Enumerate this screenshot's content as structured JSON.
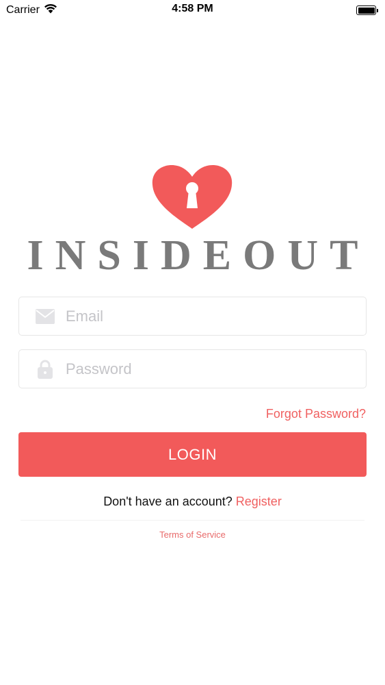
{
  "status_bar": {
    "carrier": "Carrier",
    "time": "4:58 PM"
  },
  "logo": {
    "brand_name": "INSIDEOUT",
    "heart_color": "#f25a5a",
    "icon": "heart-keyhole-icon"
  },
  "login_form": {
    "email_placeholder": "Email",
    "email_icon": "envelope-icon",
    "password_placeholder": "Password",
    "password_icon": "lock-icon",
    "forgot_password_label": "Forgot Password?",
    "login_button_label": "LOGIN",
    "no_account_text": "Don't have an account?",
    "register_label": "Register",
    "terms_label": "Terms of Service"
  },
  "colors": {
    "accent": "#f25a5a",
    "link": "#f06060",
    "logo_text": "#7a7a7a",
    "placeholder": "#c4c4c8"
  }
}
